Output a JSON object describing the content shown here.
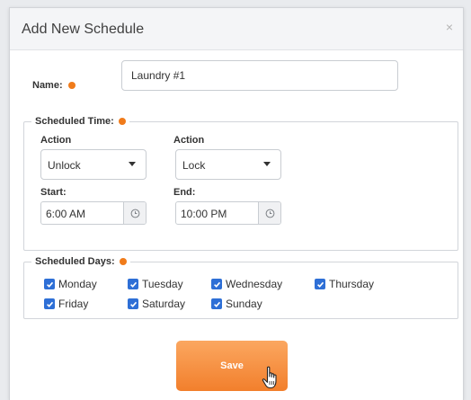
{
  "dialog": {
    "title": "Add New Schedule",
    "close_glyph": "×"
  },
  "name": {
    "label": "Name:",
    "value": "Laundry #1"
  },
  "scheduled_time": {
    "legend": "Scheduled Time:",
    "action_label_1": "Action",
    "action_value_1": "Unlock",
    "action_label_2": "Action",
    "action_value_2": "Lock",
    "start_label": "Start:",
    "start_value": "6:00 AM",
    "end_label": "End:",
    "end_value": "10:00 PM"
  },
  "scheduled_days": {
    "legend": "Scheduled Days:",
    "days": [
      {
        "label": "Monday",
        "checked": true
      },
      {
        "label": "Tuesday",
        "checked": true
      },
      {
        "label": "Wednesday",
        "checked": true
      },
      {
        "label": "Thursday",
        "checked": true
      },
      {
        "label": "Friday",
        "checked": true
      },
      {
        "label": "Saturday",
        "checked": true
      },
      {
        "label": "Sunday",
        "checked": true
      }
    ]
  },
  "actions": {
    "save_label": "Save"
  },
  "icons": {
    "required": "required-dot-icon",
    "clock": "clock-icon",
    "checkbox": "checkbox-checked-icon",
    "cursor": "hand-pointer-icon"
  },
  "colors": {
    "accent": "#f07b1a",
    "checkbox": "#2e6fd6",
    "save_top": "#fba760",
    "save_bottom": "#f27f2c"
  }
}
